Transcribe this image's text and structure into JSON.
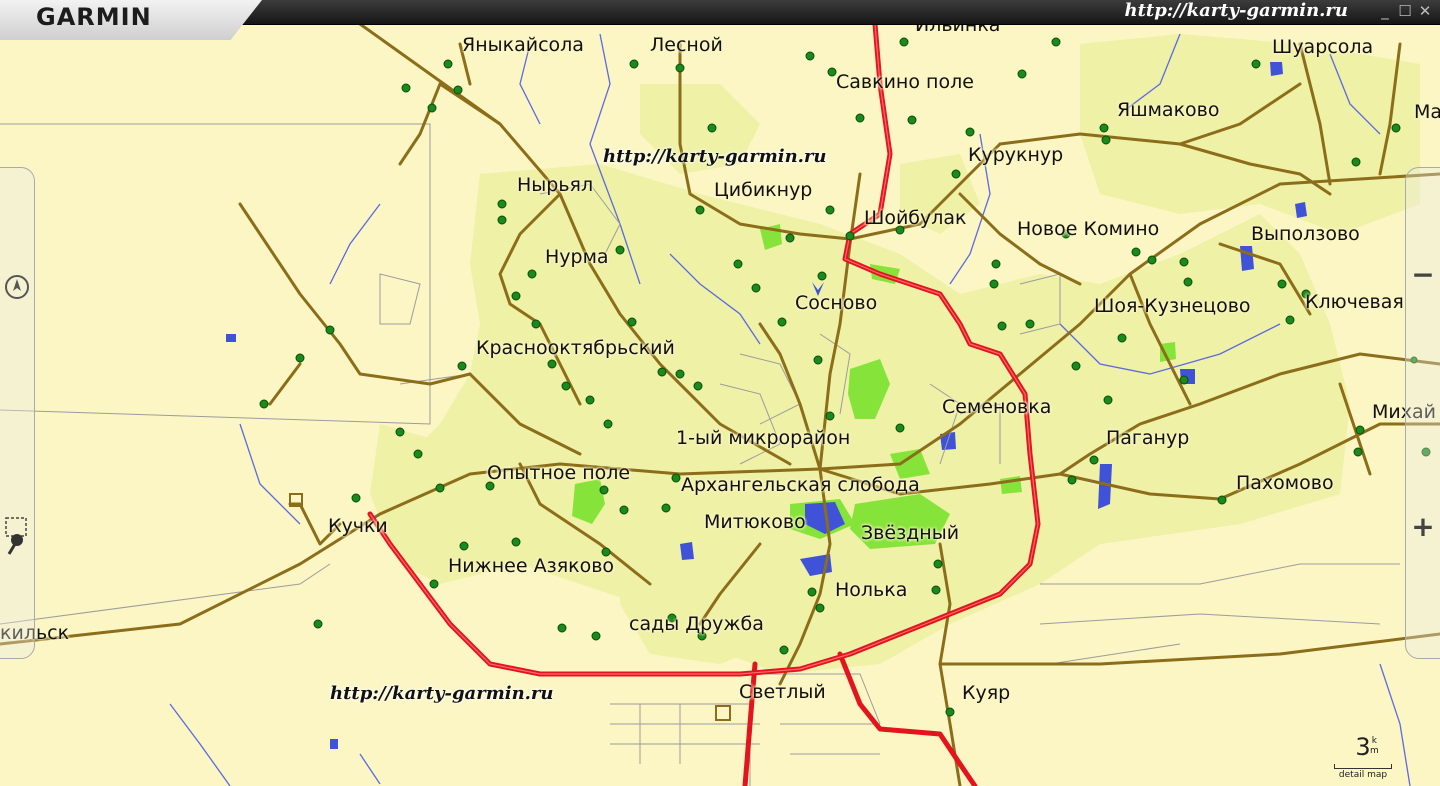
{
  "app": {
    "logo": "GARMIN",
    "title_url": "http://karty-garmin.ru",
    "window_controls": [
      "minimize-icon",
      "restore-icon",
      "close-icon"
    ]
  },
  "watermarks": [
    "http://karty-garmin.ru",
    "http://karty-garmin.ru"
  ],
  "places": [
    "Яныкайсола",
    "Лесной",
    "Ильинка",
    "Савкино поле",
    "Шуарсола",
    "Яшмаково",
    "Ма",
    "Курукнур",
    "Нырьял",
    "Цибикнур",
    "Шойбулак",
    "Нурма",
    "Новое Комино",
    "Выползово",
    "Сосново",
    "Шоя-Кузнецово",
    "Ключевая",
    "Краснооктябрьский",
    "Семеновка",
    "Михай",
    "1-ый микрорайон",
    "Паганур",
    "Опытное поле",
    "Архангельская слобода",
    "Пахомово",
    "Кучки",
    "Митюково",
    "Звёздный",
    "Нижнее Азяково",
    "Нолька",
    "кильск",
    "сады Дружба",
    "Светлый",
    "Куяр"
  ],
  "controls": {
    "left": [
      "compass-icon",
      "measure-tool-icon"
    ],
    "right": [
      "zoom-out-button",
      "zoom-in-button"
    ],
    "zoom_out": "−",
    "zoom_in": "+"
  },
  "scale": {
    "value": "3",
    "unit_top": "k",
    "unit_bottom": "m",
    "caption": "detail map"
  },
  "colors": {
    "background": "#fbf6c4",
    "urban": "#ecf0a8",
    "forest": "#8fe83a",
    "water": "#3f52d8",
    "highway": "#e3141e",
    "road": "#8c6d1a",
    "settlement_dot": "#1a8a1a"
  }
}
